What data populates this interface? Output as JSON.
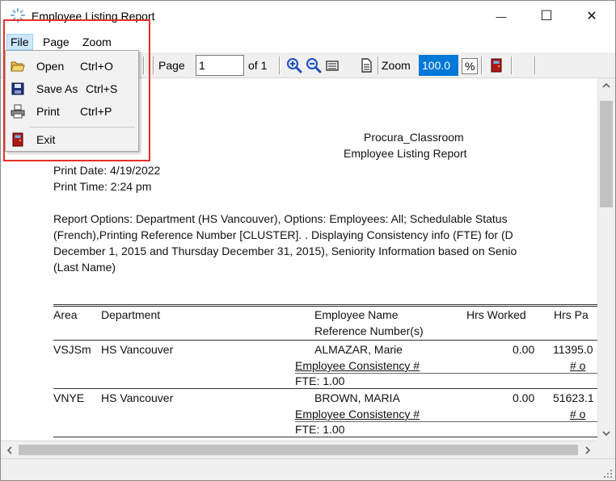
{
  "window": {
    "title": "Employee Listing Report",
    "controls": {
      "minimize": "—",
      "maximize": "☐",
      "close": "✕"
    }
  },
  "menubar": {
    "file": "File",
    "page": "Page",
    "zoom": "Zoom"
  },
  "toolbar": {
    "page_label": "Page",
    "page_value": "1",
    "of_label": "of 1",
    "zoom_label": "Zoom",
    "zoom_value": "100.0",
    "percent_label": "%"
  },
  "file_menu": {
    "items": [
      {
        "label": "Open",
        "shortcut": "Ctrl+O",
        "icon": "folder-open-icon"
      },
      {
        "label": "Save As",
        "shortcut": "Ctrl+S",
        "icon": "floppy-disk-icon"
      },
      {
        "label": "Print",
        "shortcut": "Ctrl+P",
        "icon": "printer-icon"
      },
      {
        "label": "Exit",
        "shortcut": "",
        "icon": "exit-door-icon"
      }
    ]
  },
  "report": {
    "org": "Procura_Classroom",
    "title": "Employee Listing Report",
    "print_date": "Print Date: 4/19/2022",
    "print_time": "Print Time: 2:24 pm",
    "options_lines": [
      "Report Options: Department (HS Vancouver), Options:  Employees: All; Schedulable Status",
      "(French),Printing Reference Number [CLUSTER]. . Displaying Consistency info (FTE) for (D",
      "December 1, 2015 and Thursday December 31, 2015), Seniority Information based on Senio",
      "(Last Name)"
    ],
    "headers": {
      "area": "Area",
      "department": "Department",
      "employee_name": "Employee Name",
      "reference": "Reference  Number(s)",
      "hrs_worked": "Hrs Worked",
      "hrs_paid": "Hrs Pa"
    },
    "rows": [
      {
        "area": "VSJSm",
        "department": "HS  Vancouver",
        "name": "ALMAZAR, Marie",
        "hrs_worked": "0.00",
        "hrs_paid": "11395.0",
        "consistency": "Employee Consistency #",
        "consistency_right": "# o",
        "fte": "FTE: 1.00"
      },
      {
        "area": "VNYE",
        "department": "HS  Vancouver",
        "name": "BROWN, MARIA",
        "hrs_worked": "0.00",
        "hrs_paid": "51623.1",
        "consistency": "Employee Consistency #",
        "consistency_right": "# o",
        "fte": "FTE: 1.00"
      }
    ]
  },
  "colors": {
    "highlight_border": "#e8302a",
    "menu_selected": "#cce8ff",
    "zoom_selection": "#0078d7"
  }
}
